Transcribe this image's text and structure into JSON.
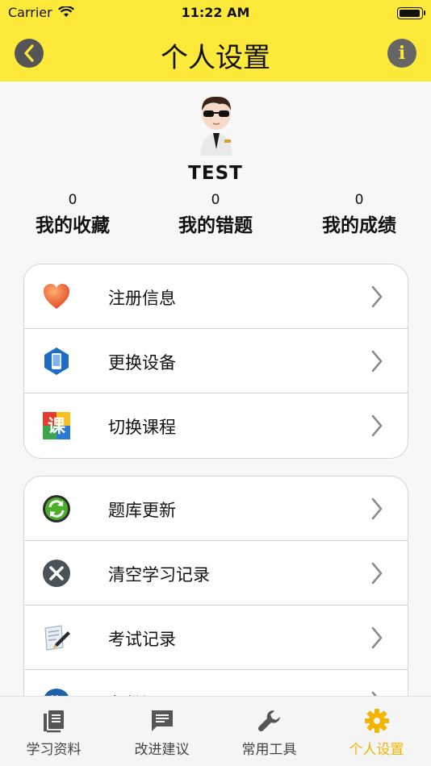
{
  "status_bar": {
    "carrier": "Carrier",
    "time": "11:22 AM"
  },
  "header": {
    "title": "个人设置"
  },
  "profile": {
    "username": "TEST",
    "stats": [
      {
        "count": "0",
        "label": "我的收藏"
      },
      {
        "count": "0",
        "label": "我的错题"
      },
      {
        "count": "0",
        "label": "我的成绩"
      }
    ]
  },
  "group1": {
    "items": [
      {
        "label": "注册信息",
        "icon": "heart-icon"
      },
      {
        "label": "更换设备",
        "icon": "phone-icon"
      },
      {
        "label": "切换课程",
        "icon": "course-icon"
      }
    ]
  },
  "group2": {
    "items": [
      {
        "label": "题库更新",
        "icon": "refresh-icon"
      },
      {
        "label": "清空学习记录",
        "icon": "clear-icon"
      },
      {
        "label": "考试记录",
        "icon": "exam-record-icon"
      },
      {
        "label": "备份还原",
        "icon": "backup-icon"
      }
    ]
  },
  "tabbar": {
    "tabs": [
      {
        "label": "学习资料",
        "icon": "books-icon"
      },
      {
        "label": "改进建议",
        "icon": "message-icon"
      },
      {
        "label": "常用工具",
        "icon": "wrench-icon"
      },
      {
        "label": "个人设置",
        "icon": "gear-icon"
      }
    ],
    "active_color": "#f3b500"
  },
  "colors": {
    "header_bg": "#fde93a",
    "page_bg": "#f7f7f7"
  },
  "icons": {
    "avatar": "pilot-avatar"
  }
}
